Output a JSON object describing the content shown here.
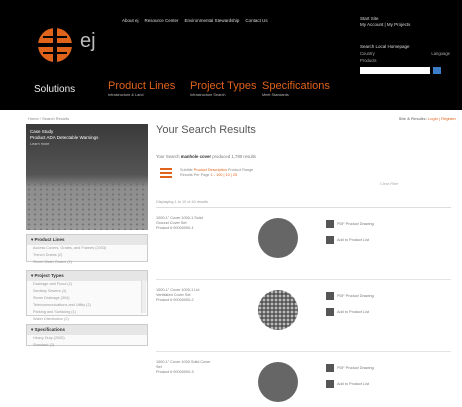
{
  "brand": {
    "logo_text": "ej",
    "accent": "#e0631b"
  },
  "top_nav": [
    "About ej",
    "Resource Center",
    "Environmental Stewardship",
    "Contact Us"
  ],
  "account": {
    "line1": "Start Site",
    "line2": "My Account | My Projects"
  },
  "login": {
    "title": "Search Local Homepage",
    "left_label": "Country",
    "right_label": "Language",
    "field_label": "Products",
    "placeholder": ""
  },
  "solutions_label": "Solutions",
  "main_nav": [
    {
      "label": "Product Lines",
      "sub": "Infrastructure & Land"
    },
    {
      "label": "Project Types",
      "sub": "Infrastructure Search"
    },
    {
      "label": "Specifications",
      "sub": "Meet Standards"
    }
  ],
  "breadcrumb": "Home / Search Results",
  "results_count": {
    "prefix": "Site & Results:",
    "link": "Login | Register"
  },
  "hero": {
    "line1": "Case Study",
    "line2": "Product ADA Detectable Warnings",
    "line3": "Learn more"
  },
  "sidebar": {
    "product_lines": {
      "header": "Product Lines",
      "items": [
        "Access Covers, Grates, and Frames (2003)",
        "Trench Drains (2)",
        "Storm Water Drains (1)"
      ]
    },
    "project_types": {
      "header": "Project Types",
      "items": [
        "Drainage and Flood (2)",
        "Sanitary Sewers (1)",
        "Storm Drainage (304)",
        "Telecommunications and Utility (2)",
        "Parking and Surfacing (1)",
        "Water Distribution (2)"
      ]
    },
    "specifications": {
      "header": "Specifications",
      "items": [
        "Heavy Duty (2005)",
        "Standard (2)"
      ]
    }
  },
  "main": {
    "title": "Your Search Results",
    "summary_prefix": "Your Search",
    "summary_term": "manhole cover",
    "summary_suffix": "produced 1,780 results",
    "filter": {
      "label": "Subtitle",
      "term": "Product Description",
      "suffix": "Product Range",
      "range": "Results Per Page",
      "range_value": "1 - 100 | 10 | 25"
    },
    "clear_link": "Clear Filter",
    "sort_line": "Displaying 1 to 10 of 40 results",
    "products": [
      {
        "name": "1000-1\" Cover 1000-1 Solid Ground Cover Set",
        "code": "Product # 00000000-1",
        "cover": "solid",
        "action1": "PDF Product Drawing",
        "action2": "Add to Product List"
      },
      {
        "name": "1000-1\" Cover 1000-1 Lid Ventilated Cover Set",
        "code": "Product # 00000000-2",
        "cover": "vent",
        "action1": "PDF Product Drawing",
        "action2": "Add to Product List"
      },
      {
        "name": "1000-1\" Cover 1000 Solid Cover Set",
        "code": "Product # 00000000-3",
        "cover": "solid",
        "action1": "PDF Product Drawing",
        "action2": "Add to Product List"
      }
    ]
  }
}
